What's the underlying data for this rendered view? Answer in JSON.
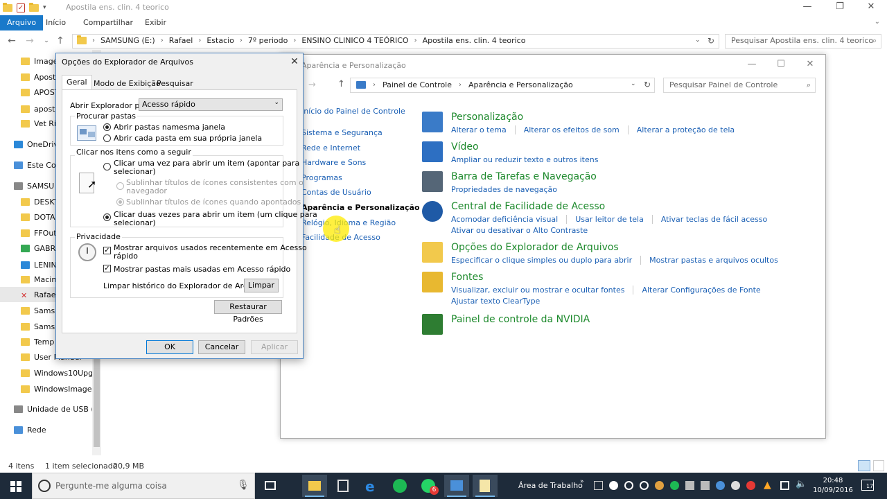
{
  "explorer": {
    "window_title": "Apostila ens. clin. 4 teorico",
    "ribbon_tabs": [
      "Arquivo",
      "Início",
      "Compartilhar",
      "Exibir"
    ],
    "breadcrumb": [
      "SAMSUNG (E:)",
      "Rafael",
      "Estacio",
      "7º periodo",
      "ENSINO CLINICO 4 TEÓRICO",
      "Apostila ens. clin. 4 teorico"
    ],
    "search_placeholder": "Pesquisar Apostila ens. clin. 4 teorico",
    "nav_items": [
      "Image",
      "Apost",
      "APOST",
      "aposti",
      "Vet Ric",
      "OneDriv",
      "Este Co",
      "SAMSU",
      "DESKT",
      "DOTA",
      "FFOut",
      "GABRI",
      "LENIN",
      "Macin",
      "Rafael",
      "Samsu",
      "Samsu",
      "Temp",
      "User Manuel",
      "Windows10Upgr",
      "WindowsImageE",
      "Unidade de USB (I",
      "Rede"
    ],
    "status_items": "4 itens",
    "status_selected": "1 item selecionado",
    "status_size": "20,9 MB"
  },
  "control_panel": {
    "window_title": "Aparência e Personalização",
    "breadcrumb": [
      "Painel de Controle",
      "Aparência e Personalização"
    ],
    "search_placeholder": "Pesquisar Painel de Controle",
    "left_nav": [
      "Início do Painel de Controle",
      "Sistema e Segurança",
      "Rede e Internet",
      "Hardware e Sons",
      "Programas",
      "Contas de Usuário",
      "Aparência e Personalização",
      "Relógio, Idioma e Região",
      "Facilidade de Acesso"
    ],
    "categories": [
      {
        "title": "Personalização",
        "links": [
          "Alterar o tema",
          "Alterar os efeitos de som",
          "Alterar a proteção de tela"
        ],
        "links2": ""
      },
      {
        "title": "Vídeo",
        "links": [
          "Ampliar ou reduzir texto e outros itens"
        ],
        "links2": ""
      },
      {
        "title": "Barra de Tarefas e Navegação",
        "links": [
          "Propriedades de navegação"
        ],
        "links2": ""
      },
      {
        "title": "Central de Facilidade de Acesso",
        "links": [
          "Acomodar deficiência visual",
          "Usar leitor de tela",
          "Ativar teclas de fácil acesso"
        ],
        "links2": "Ativar ou desativar o Alto Contraste"
      },
      {
        "title": "Opções do Explorador de Arquivos",
        "links": [
          "Especificar o clique simples ou duplo para abrir",
          "Mostrar pastas e arquivos ocultos"
        ],
        "links2": ""
      },
      {
        "title": "Fontes",
        "links": [
          "Visualizar, excluir ou mostrar e ocultar fontes",
          "Alterar Configurações de Fonte"
        ],
        "links2": "Ajustar texto ClearType"
      },
      {
        "title": "Painel de controle da NVIDIA",
        "links": [],
        "links2": ""
      }
    ]
  },
  "dialog": {
    "title": "Opções do Explorador de Arquivos",
    "tabs": [
      "Geral",
      "Modo de Exibição",
      "Pesquisar"
    ],
    "open_label": "Abrir Explorador para:",
    "open_value": "Acesso rápido",
    "browse_group": "Procurar pastas",
    "browse_opt1": "Abrir pastas namesma janela",
    "browse_opt2": "Abrir cada pasta em sua própria janela",
    "click_group": "Clicar nos itens como a seguir",
    "click_opt1a": "Clicar uma vez para abrir um item (apontar para",
    "click_opt1b": "selecionar)",
    "click_sub1a": "Sublinhar títulos de ícones consistentes com o",
    "click_sub1b": "navegador",
    "click_sub2": "Sublinhar títulos de ícones quando apontados",
    "click_opt2a": "Clicar duas vezes para abrir um item (um clique para",
    "click_opt2b": "selecionar)",
    "privacy_group": "Privacidade",
    "privacy_chk1a": "Mostrar arquivos usados recentemente em Acesso",
    "privacy_chk1b": "rápido",
    "privacy_chk2": "Mostrar pastas mais usadas em Acesso rápido",
    "clear_label": "Limpar histórico do Explorador de Arquivos",
    "clear_button": "Limpar",
    "restore_button": "Restaurar Padrões",
    "ok": "OK",
    "cancel": "Cancelar",
    "apply": "Aplicar"
  },
  "taskbar": {
    "cortana_placeholder": "Pergunte-me alguma coisa",
    "desktop_label": "Área de Trabalho",
    "time": "20:48",
    "date": "10/09/2016",
    "notification_badge": "6",
    "notif_count": "17"
  }
}
